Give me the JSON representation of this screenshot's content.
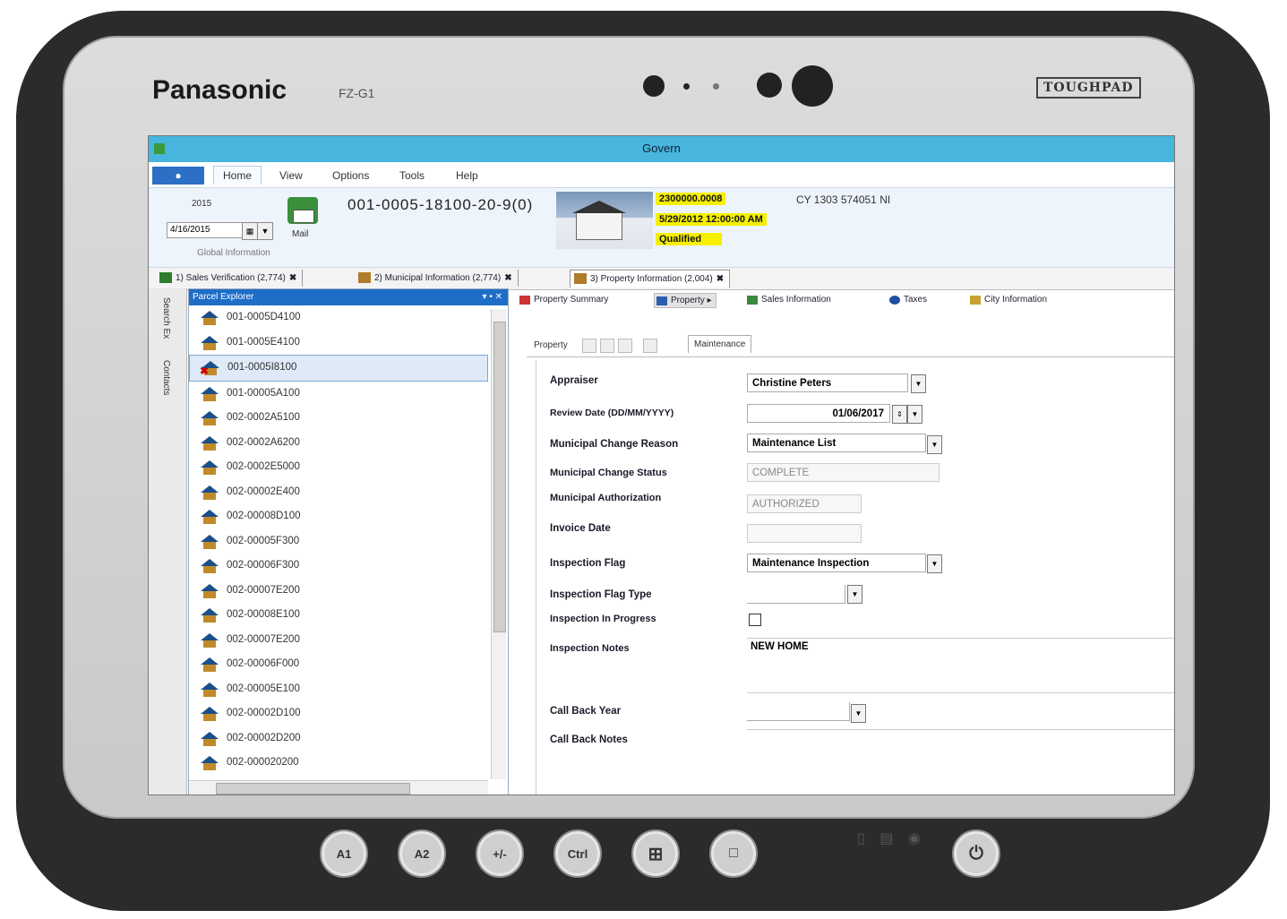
{
  "device": {
    "brand": "Panasonic",
    "model": "FZ-G1",
    "badge": "TOUGHPAD",
    "buttons": [
      "A1",
      "A2",
      "+/-",
      "Ctrl"
    ]
  },
  "window": {
    "title": "Govern"
  },
  "ribbon": {
    "tabs": [
      "Home",
      "View",
      "Options",
      "Tools",
      "Help"
    ],
    "year": "2015",
    "date": "4/16/2015",
    "global_label": "Global Information",
    "mail_label": "Mail",
    "property_id": "001-0005-18100-20-9(0)",
    "info_account": "2300000.0008",
    "info_datetime": "5/29/2012 12:00:00 AM",
    "info_status": "Qualified",
    "coords": "CY 1303 574051 NI"
  },
  "doc_tabs": [
    {
      "label": "1) Sales Verification (2,774)"
    },
    {
      "label": "2) Municipal Information (2,774)"
    },
    {
      "label": "3) Property Information (2,004)"
    }
  ],
  "left_tabs": [
    "Search Ex",
    "Contacts"
  ],
  "explorer": {
    "title": "Parcel Explorer",
    "items": [
      "001-0005D4100",
      "001-0005E4100",
      "001-0005I8100",
      "001-00005A100",
      "002-0002A5100",
      "002-0002A6200",
      "002-0002E5000",
      "002-00002E400",
      "002-00008D100",
      "002-00005F300",
      "002-00006F300",
      "002-00007E200",
      "002-00008E100",
      "002-00007E200",
      "002-00006F000",
      "002-00005E100",
      "002-00002D100",
      "002-00002D200",
      "002-000020200"
    ],
    "selected_index": 2
  },
  "content_tabs": [
    "Property Summary",
    "Property",
    "Sales Information",
    "Taxes",
    "City Information"
  ],
  "sub_tabs": [
    "Property",
    "Maintenance"
  ],
  "form": {
    "appraiser_label": "Appraiser",
    "appraiser_value": "Christine Peters",
    "review_date_label": "Review Date (DD/MM/YYYY)",
    "review_date_value": "01/06/2017",
    "change_reason_label": "Municipal Change Reason",
    "change_reason_value": "Maintenance List",
    "change_status_label": "Municipal Change Status",
    "change_status_value": "COMPLETE",
    "authorization_label": "Municipal Authorization",
    "authorization_value": "AUTHORIZED",
    "invoice_date_label": "Invoice Date",
    "inspection_flag_label": "Inspection Flag",
    "inspection_flag_value": "Maintenance Inspection",
    "flag_type_label": "Inspection Flag Type",
    "in_progress_label": "Inspection In Progress",
    "notes_label": "Inspection Notes",
    "notes_value": "NEW HOME",
    "callback_year_label": "Call Back Year",
    "callback_notes_label": "Call Back Notes"
  }
}
